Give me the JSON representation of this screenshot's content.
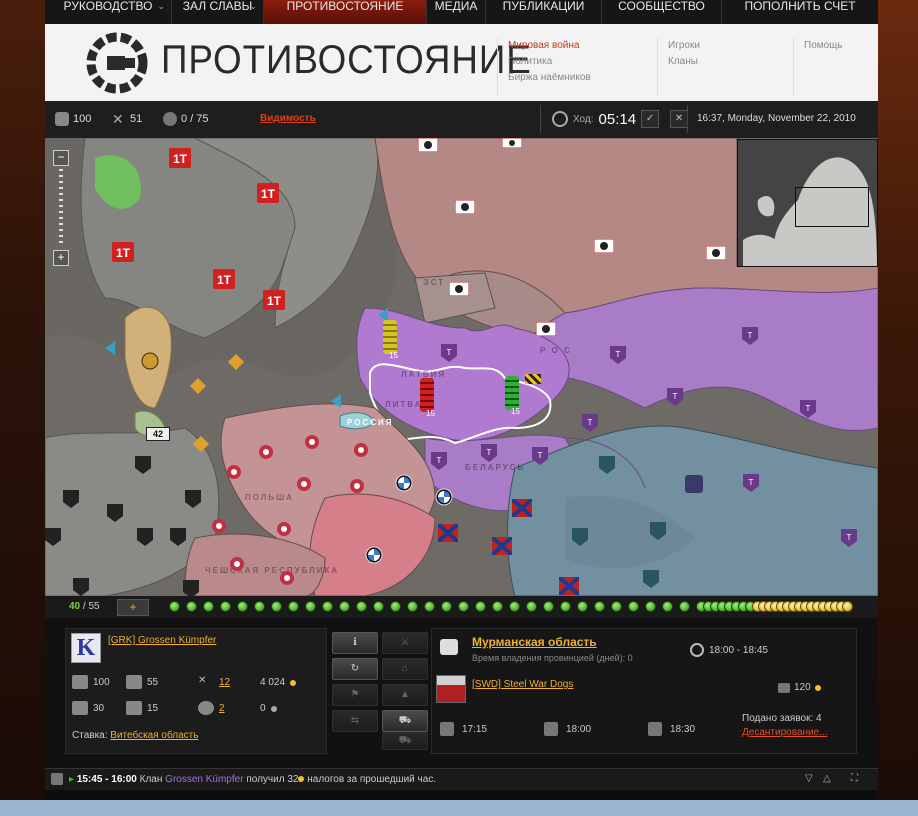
{
  "nav": {
    "items": [
      {
        "label": "РУКОВОДСТВО",
        "dropdown": true
      },
      {
        "label": "ЗАЛ СЛАВЫ",
        "dropdown": true
      },
      {
        "label": "ПРОТИВОСТОЯНИЕ",
        "active": true
      },
      {
        "label": "МЕДИА"
      },
      {
        "label": "ПУБЛИКАЦИИ"
      },
      {
        "label": "СООБЩЕСТВО"
      },
      {
        "label": "ПОПОЛНИТЬ СЧЕТ"
      }
    ]
  },
  "header": {
    "title": "ПРОТИВОСТОЯНИЕ",
    "col1": [
      "Мировая война",
      "Политика",
      "Биржа наёмников"
    ],
    "col2": [
      "Игроки",
      "Кланы"
    ],
    "col3": [
      "Помощь"
    ]
  },
  "status": {
    "tanks": "100",
    "battles": "51",
    "provinces": "0 / 75",
    "visibility": "Видимость",
    "turn_label": "Ход:",
    "turn_time": "05:14",
    "datetime": "16:37, Monday, November 22, 2010"
  },
  "map": {
    "region_labels": [
      "ЭСТ",
      "ЛАТВИЯ",
      "ЛИТВА",
      "БЕЛАРУСЬ",
      "ПОЛЬША",
      "ЧЕШСКАЯ РЕСПУБЛИКА",
      "Р О С",
      "РОССИЯ"
    ],
    "tokens": [
      {
        "color": "#d4c020",
        "count": "15"
      },
      {
        "color": "#c01818",
        "count": "15"
      },
      {
        "color": "#28a030",
        "count": "15"
      }
    ],
    "marker_badge": "42"
  },
  "progress": {
    "current": "40",
    "total": "55",
    "add": "+",
    "green": 39,
    "yellow": 16
  },
  "clan": {
    "logo_letter": "K",
    "name": "[GRK] Grossen Kümpfer",
    "stats": {
      "tanks": "100",
      "hangar": "55",
      "battles": "12",
      "gold": "4 024",
      "map": "30",
      "turns": "15",
      "flags": "2",
      "zero": "0"
    },
    "bid_label": "Ставка:",
    "bid_region": "Витебская область"
  },
  "province": {
    "name": "Мурманская область",
    "note": "Время владения провинцией (дней): 0",
    "prime_time": "18:00 - 18:45",
    "enemy": "[SWD] Steel War Dogs",
    "enemy_bid": "120",
    "times": [
      "17:15",
      "18:00",
      "18:30"
    ],
    "bids_total": "Подано заявок: 4",
    "landing": "Десантирование..."
  },
  "ticker": {
    "time": "15:45 - 16:00",
    "pre": "Клан",
    "clan": "Grossen Kümpfer",
    "mid": "получил 32",
    "post": "налогов за прошедший час."
  },
  "colors": {
    "accent": "#c13a1c",
    "gold": "#f0b030",
    "purple": "#b07ad0",
    "green": "#7fd040"
  }
}
